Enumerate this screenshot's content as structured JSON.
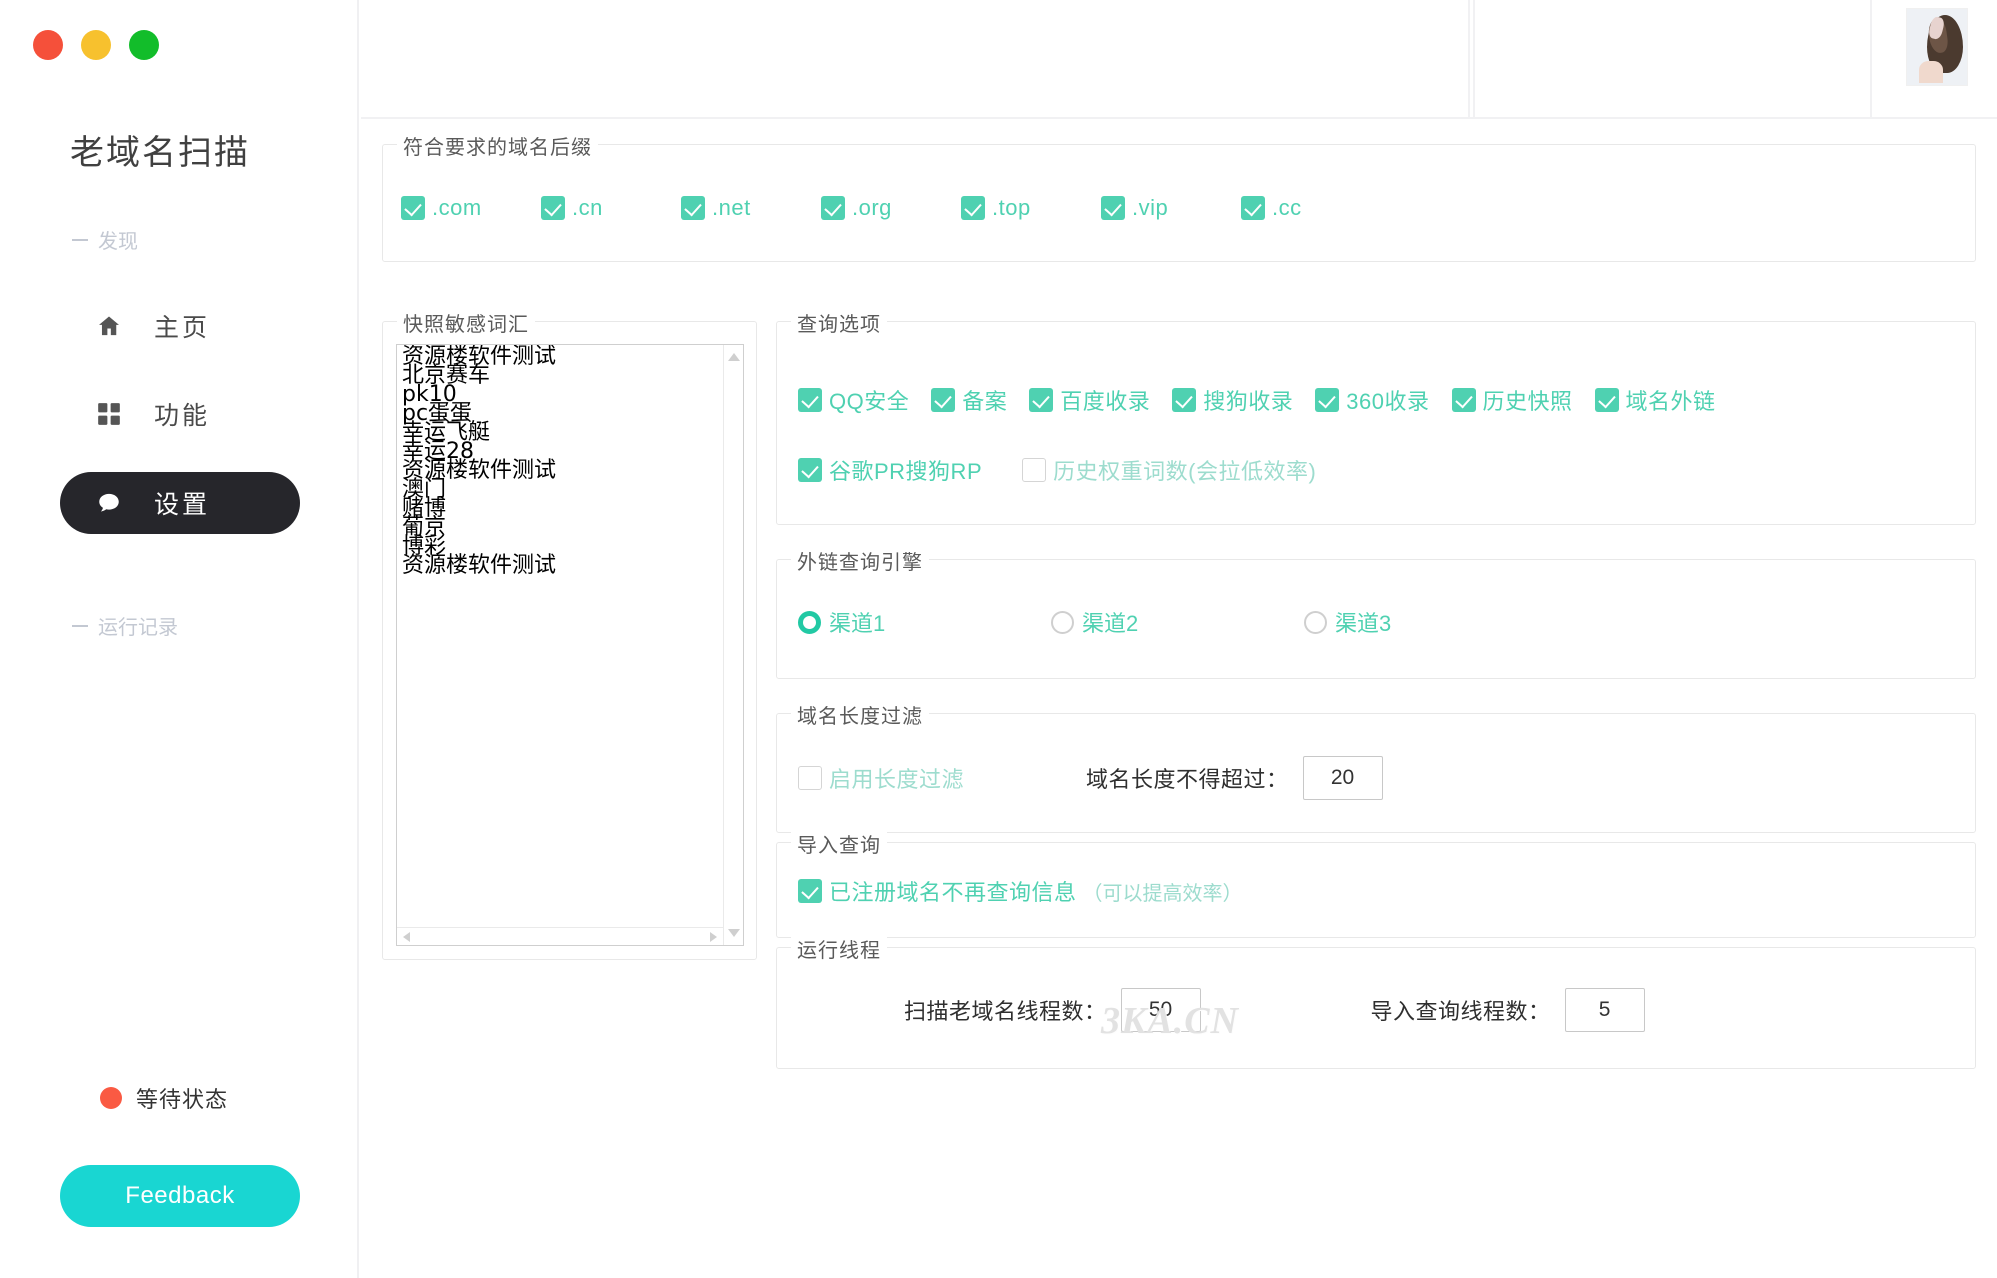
{
  "window": {
    "traffic_lights": [
      "close",
      "minimize",
      "maximize"
    ]
  },
  "sidebar": {
    "app_title": "老域名扫描",
    "group_discover": "发现",
    "group_runlog": "运行记录",
    "nav": [
      {
        "label": "主页",
        "icon": "home-icon",
        "active": false
      },
      {
        "label": "功能",
        "icon": "grid-icon",
        "active": false
      },
      {
        "label": "设置",
        "icon": "chat-icon",
        "active": true
      }
    ],
    "status": {
      "text": "等待状态",
      "color": "#fa5a43"
    },
    "feedback_label": "Feedback"
  },
  "watermark": "3KA.CN",
  "suffix_group": {
    "legend": "符合要求的域名后缀",
    "items": [
      {
        "label": ".com",
        "checked": true
      },
      {
        "label": ".cn",
        "checked": true
      },
      {
        "label": ".net",
        "checked": true
      },
      {
        "label": ".org",
        "checked": true
      },
      {
        "label": ".top",
        "checked": true
      },
      {
        "label": ".vip",
        "checked": true
      },
      {
        "label": ".cc",
        "checked": true
      }
    ]
  },
  "words_group": {
    "legend": "快照敏感词汇",
    "words": [
      "资源楼软件测试",
      "北京赛车",
      "pk10",
      "pc蛋蛋",
      "幸运飞艇",
      "幸运28",
      "资源楼软件测试",
      "澳门",
      "赌博",
      "葡京",
      "博彩",
      "资源楼软件测试"
    ]
  },
  "query_group": {
    "legend": "查询选项",
    "row1": [
      {
        "label": "QQ安全",
        "checked": true
      },
      {
        "label": "备案",
        "checked": true
      },
      {
        "label": "百度收录",
        "checked": true
      },
      {
        "label": "搜狗收录",
        "checked": true
      },
      {
        "label": "360收录",
        "checked": true
      },
      {
        "label": "历史快照",
        "checked": true
      },
      {
        "label": "域名外链",
        "checked": true
      }
    ],
    "row2": [
      {
        "label": "谷歌PR搜狗RP",
        "checked": true
      },
      {
        "label": "历史权重词数(会拉低效率)",
        "checked": false
      }
    ]
  },
  "engine_group": {
    "legend": "外链查询引擎",
    "options": [
      {
        "label": "渠道1",
        "selected": true
      },
      {
        "label": "渠道2",
        "selected": false
      },
      {
        "label": "渠道3",
        "selected": false
      }
    ]
  },
  "length_group": {
    "legend": "域名长度过滤",
    "enable_label": "启用长度过滤",
    "enable_checked": false,
    "max_label": "域名长度不得超过：",
    "max_value": "20"
  },
  "import_group": {
    "legend": "导入查询",
    "checkbox_label": "已注册域名不再查询信息",
    "checkbox_note": "（可以提高效率）",
    "checked": true
  },
  "threads_group": {
    "legend": "运行线程",
    "scan_label": "扫描老域名线程数：",
    "scan_value": "50",
    "import_label": "导入查询线程数：",
    "import_value": "5"
  },
  "colors": {
    "accent_teal": "#4fd1b1",
    "feedback_cyan": "#19d6d2",
    "active_nav": "#26262b",
    "status_red": "#fa5a43"
  }
}
